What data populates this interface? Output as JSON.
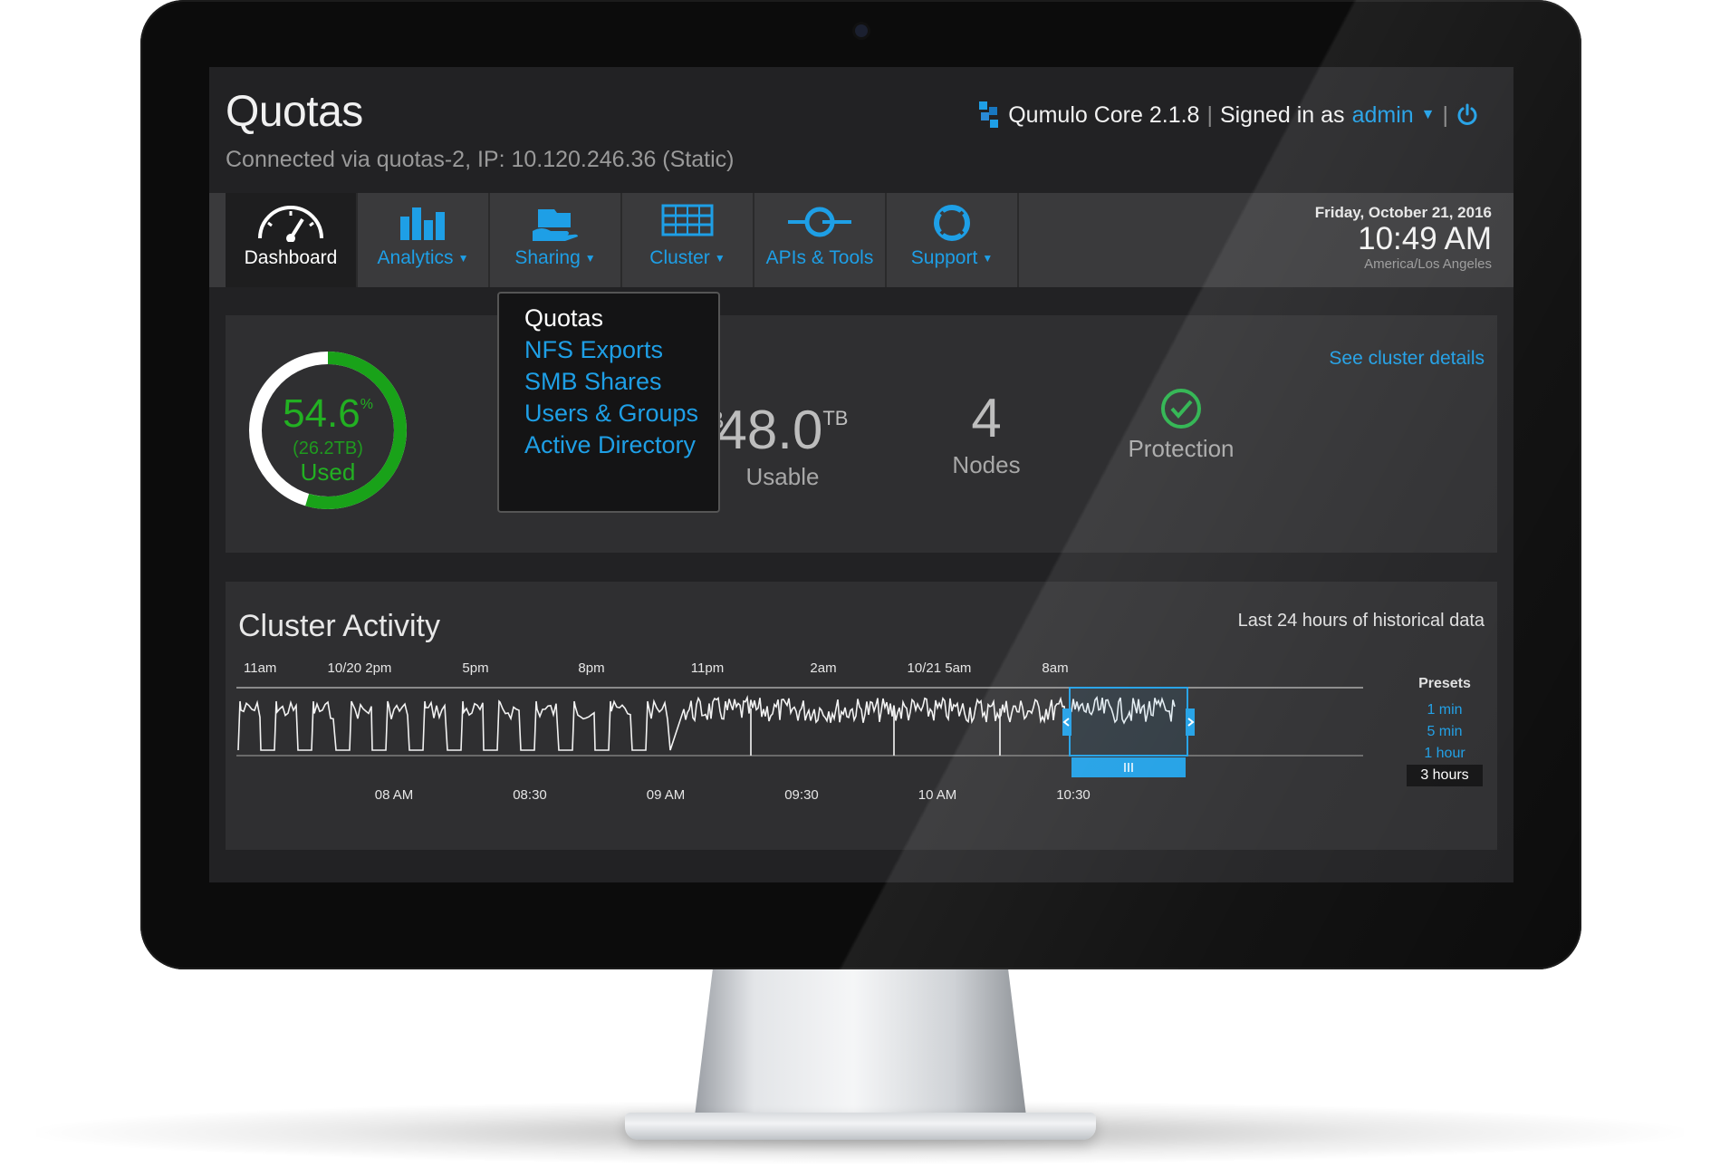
{
  "app": {
    "page_title": "Quotas",
    "connection": "Connected via quotas-2, IP: 10.120.246.36 (Static)",
    "product": "Qumulo Core 2.1.8",
    "signed_in_prefix": "Signed in as",
    "user": "admin"
  },
  "nav": {
    "tabs": [
      {
        "label": "Dashboard",
        "icon": "speedometer-icon",
        "active": true
      },
      {
        "label": "Analytics",
        "icon": "bar-chart-icon",
        "dropdown": true
      },
      {
        "label": "Sharing",
        "icon": "sharing-hand-icon",
        "dropdown": true
      },
      {
        "label": "Cluster",
        "icon": "server-rack-icon",
        "dropdown": true
      },
      {
        "label": "APIs & Tools",
        "icon": "plug-icon"
      },
      {
        "label": "Support",
        "icon": "lifebuoy-icon",
        "dropdown": true
      }
    ],
    "date": "Friday, October 21, 2016",
    "time": "10:49 AM",
    "timezone": "America/Los Angeles"
  },
  "sharing_menu": {
    "items": [
      "Quotas",
      "NFS Exports",
      "SMB Shares",
      "Users & Groups",
      "Active Directory"
    ],
    "current": "Quotas"
  },
  "stats": {
    "used_percent": "54.6",
    "used_percent_value": 54.6,
    "percent_sign": "%",
    "used_tb": "(26.2TB)",
    "used_label": "Used",
    "hidden_fragment": "B",
    "usable_value": "48.0",
    "usable_unit": "TB",
    "usable_label": "Usable",
    "nodes_value": "4",
    "nodes_label": "Nodes",
    "protection_label": "Protection",
    "see_details": "See cluster details"
  },
  "activity": {
    "title": "Cluster Activity",
    "subtitle": "Last 24 hours of historical data",
    "top_ticks": [
      "11am",
      "10/20 2pm",
      "5pm",
      "8pm",
      "11pm",
      "2am",
      "10/21 5am",
      "8am"
    ],
    "bottom_ticks": [
      "08 AM",
      "08:30",
      "09 AM",
      "09:30",
      "10 AM",
      "10:30"
    ],
    "presets_label": "Presets",
    "presets": [
      "1 min",
      "5 min",
      "1 hour",
      "3 hours"
    ],
    "selected_preset": "3 hours"
  },
  "colors": {
    "accent": "#1e9fe6",
    "used_green": "#22b022",
    "protection_green": "#27b24a"
  }
}
